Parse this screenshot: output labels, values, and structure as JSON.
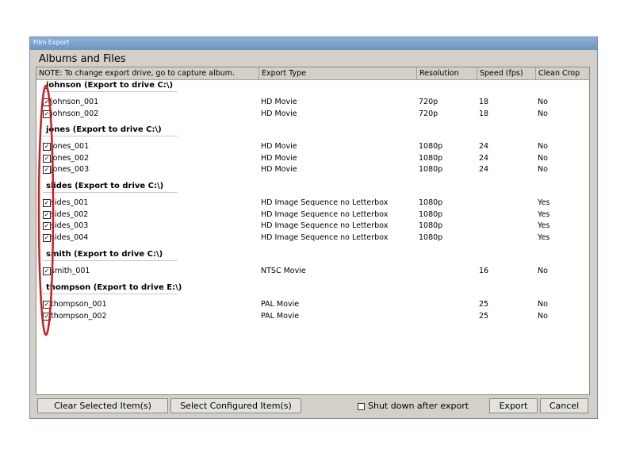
{
  "window": {
    "title": "Film Export"
  },
  "heading": "Albums and Files",
  "columns": [
    "NOTE: To change export drive, go to capture album.",
    "Export Type",
    "Resolution",
    "Speed (fps)",
    "Clean Crop"
  ],
  "groups": [
    {
      "label": "johnson (Export to drive C:\\)",
      "items": [
        {
          "name": "johnson_001",
          "type": "HD Movie",
          "resolution": "720p",
          "speed": "18",
          "crop": "No",
          "checked": true
        },
        {
          "name": "johnson_002",
          "type": "HD Movie",
          "resolution": "720p",
          "speed": "18",
          "crop": "No",
          "checked": true
        }
      ]
    },
    {
      "label": "jones (Export to drive C:\\)",
      "items": [
        {
          "name": "jones_001",
          "type": "HD Movie",
          "resolution": "1080p",
          "speed": "24",
          "crop": "No",
          "checked": true
        },
        {
          "name": "jones_002",
          "type": "HD Movie",
          "resolution": "1080p",
          "speed": "24",
          "crop": "No",
          "checked": true
        },
        {
          "name": "jones_003",
          "type": "HD Movie",
          "resolution": "1080p",
          "speed": "24",
          "crop": "No",
          "checked": true
        }
      ]
    },
    {
      "label": "slides (Export to drive C:\\)",
      "items": [
        {
          "name": "sides_001",
          "type": "HD Image Sequence no Letterbox",
          "resolution": "1080p",
          "speed": "",
          "crop": "Yes",
          "checked": true
        },
        {
          "name": "sides_002",
          "type": "HD Image Sequence no Letterbox",
          "resolution": "1080p",
          "speed": "",
          "crop": "Yes",
          "checked": true
        },
        {
          "name": "sides_003",
          "type": "HD Image Sequence no Letterbox",
          "resolution": "1080p",
          "speed": "",
          "crop": "Yes",
          "checked": true
        },
        {
          "name": "sides_004",
          "type": "HD Image Sequence no Letterbox",
          "resolution": "1080p",
          "speed": "",
          "crop": "Yes",
          "checked": true
        }
      ]
    },
    {
      "label": "smith (Export to drive C:\\)",
      "items": [
        {
          "name": "smith_001",
          "type": "NTSC Movie",
          "resolution": "",
          "speed": "16",
          "crop": "No",
          "checked": true
        }
      ]
    },
    {
      "label": "thompson (Export to drive E:\\)",
      "items": [
        {
          "name": "thompson_001",
          "type": "PAL Movie",
          "resolution": "",
          "speed": "25",
          "crop": "No",
          "checked": true
        },
        {
          "name": "thompson_002",
          "type": "PAL Movie",
          "resolution": "",
          "speed": "25",
          "crop": "No",
          "checked": true
        }
      ]
    }
  ],
  "buttons": {
    "clear": "Clear Selected Item(s)",
    "select": "Select Configured Item(s)",
    "export": "Export",
    "cancel": "Cancel"
  },
  "shutdown": {
    "label": "Shut down after export",
    "checked": false
  },
  "colors": {
    "annotation": "#cc1f1f",
    "titlebar": "#7a9dcb"
  }
}
